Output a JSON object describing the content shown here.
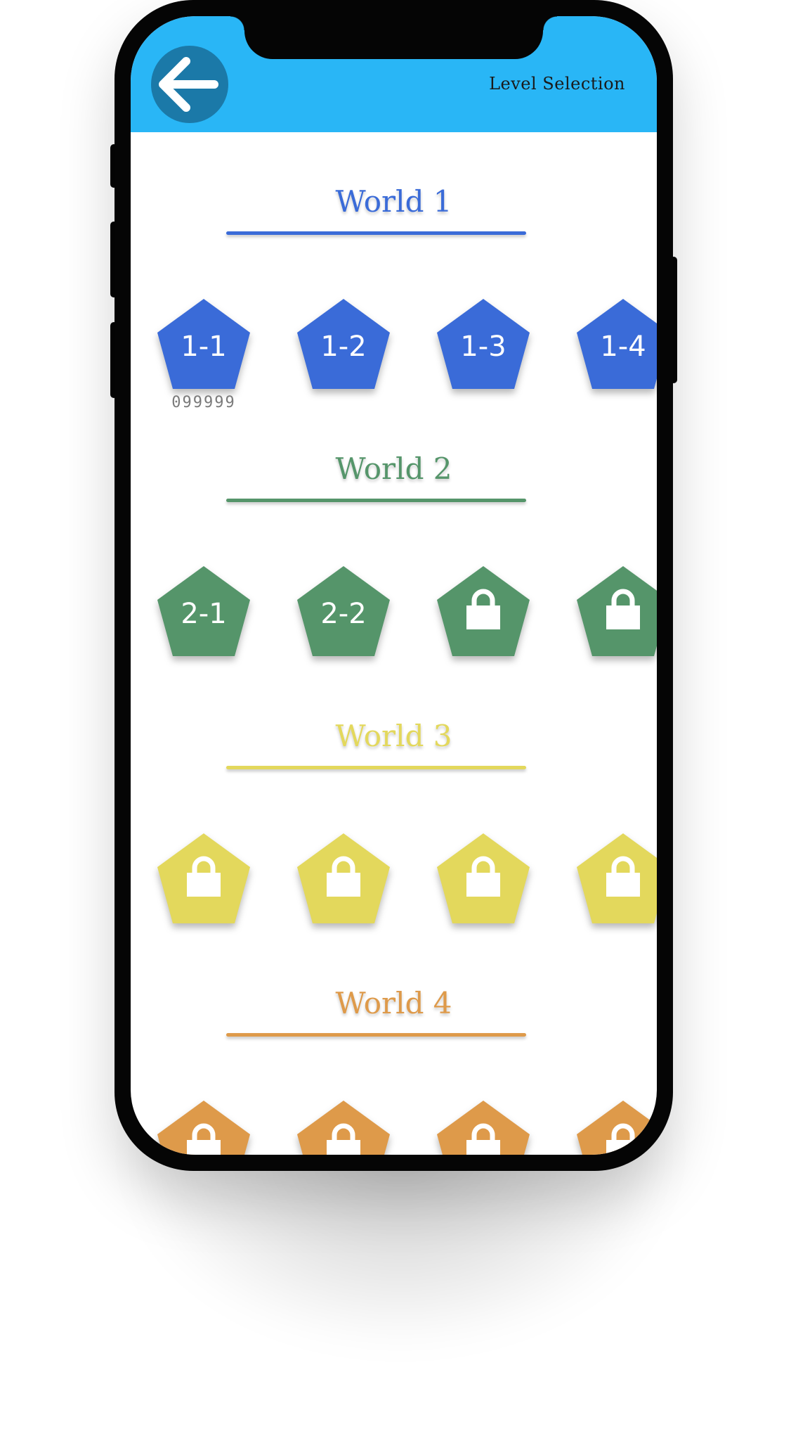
{
  "app": {
    "title": "Level Selection",
    "back_icon": "arrow-left-icon",
    "appbar_color": "#29b6f6",
    "back_button_color": "#1b79a8"
  },
  "worlds": [
    {
      "title": "World 1",
      "color": "#3a6bd8",
      "levels": [
        {
          "label": "1-1",
          "locked": false,
          "score": "099999"
        },
        {
          "label": "1-2",
          "locked": false
        },
        {
          "label": "1-3",
          "locked": false
        },
        {
          "label": "1-4",
          "locked": false
        }
      ]
    },
    {
      "title": "World 2",
      "color": "#55956a",
      "levels": [
        {
          "label": "2-1",
          "locked": false
        },
        {
          "label": "2-2",
          "locked": false
        },
        {
          "label": "",
          "locked": true
        },
        {
          "label": "",
          "locked": true
        }
      ]
    },
    {
      "title": "World 3",
      "color": "#e3d85c",
      "levels": [
        {
          "label": "",
          "locked": true
        },
        {
          "label": "",
          "locked": true
        },
        {
          "label": "",
          "locked": true
        },
        {
          "label": "",
          "locked": true
        }
      ]
    },
    {
      "title": "World 4",
      "color": "#de9a4a",
      "levels": [
        {
          "label": "",
          "locked": true
        },
        {
          "label": "",
          "locked": true
        },
        {
          "label": "",
          "locked": true
        },
        {
          "label": "",
          "locked": true
        }
      ]
    }
  ],
  "lock_icon": "lock-icon"
}
